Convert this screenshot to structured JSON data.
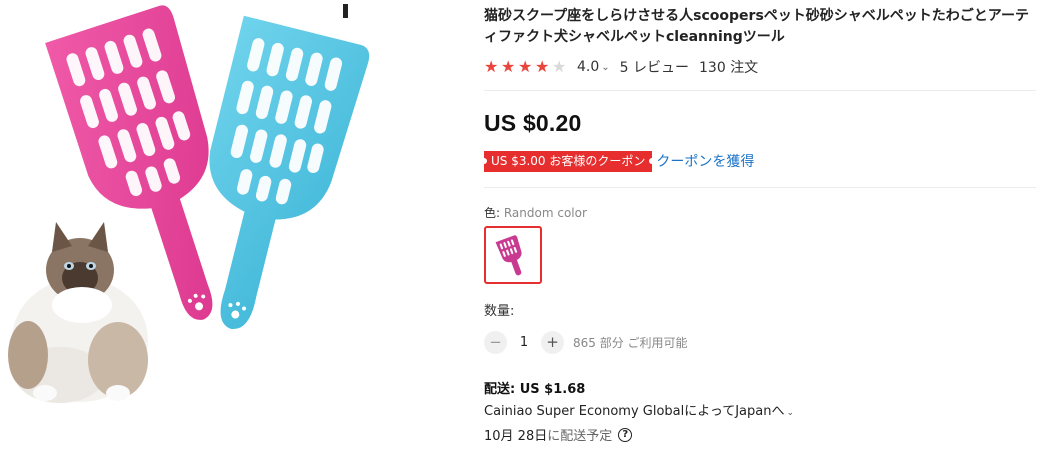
{
  "gallery": {
    "image_alt_name": "product-image-pink-and-blue-scoops-with-cat"
  },
  "product": {
    "title": "猫砂スクープ座をしらけさせる人scoopersペット砂砂シャベルペットたわごとアーティファクト犬シャベルペットcleanningツール",
    "rating": {
      "stars_filled": 4,
      "stars_total": 5,
      "score": "4.0",
      "reviews": "5 レビュー",
      "orders": "130 注文"
    },
    "price": "US $0.20",
    "coupon": {
      "badge": "US $3.00 お客様のクーポン",
      "link": "クーポンを獲得"
    },
    "color": {
      "label": "色: ",
      "value": "Random color"
    },
    "quantity": {
      "label": "数量:",
      "value": "1",
      "minus": "−",
      "plus": "+",
      "available": "865 部分 ご利用可能"
    },
    "shipping": {
      "label": "配送: US $1.68",
      "carrier": "Cainiao Super Economy GlobalによってJapanへ",
      "date_strong": "10月 28日",
      "date_suffix": "に配送予定",
      "help": "?"
    }
  },
  "colors": {
    "accent_red": "#e62e2e",
    "link_blue": "#1a73c7",
    "pink_scoop": "#e8449a",
    "blue_scoop": "#4cc3e0"
  },
  "icons": {
    "star": "★",
    "chevron": "⌄"
  }
}
